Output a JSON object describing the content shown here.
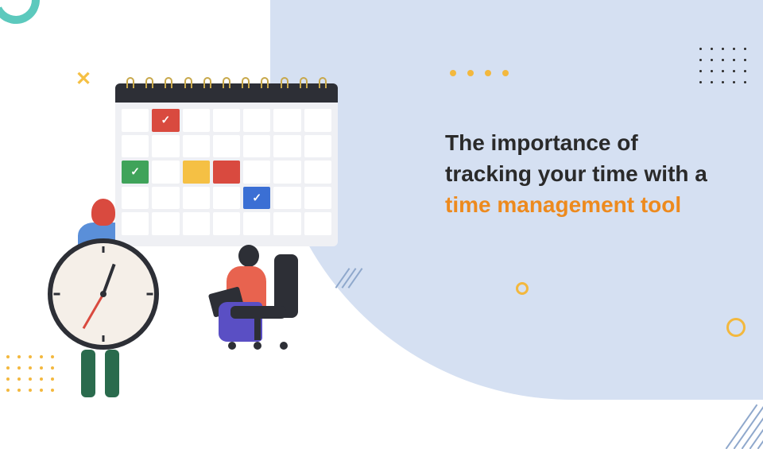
{
  "headline": {
    "line1": "The importance of",
    "line2": "tracking your time with a",
    "highlight": "time management tool"
  }
}
